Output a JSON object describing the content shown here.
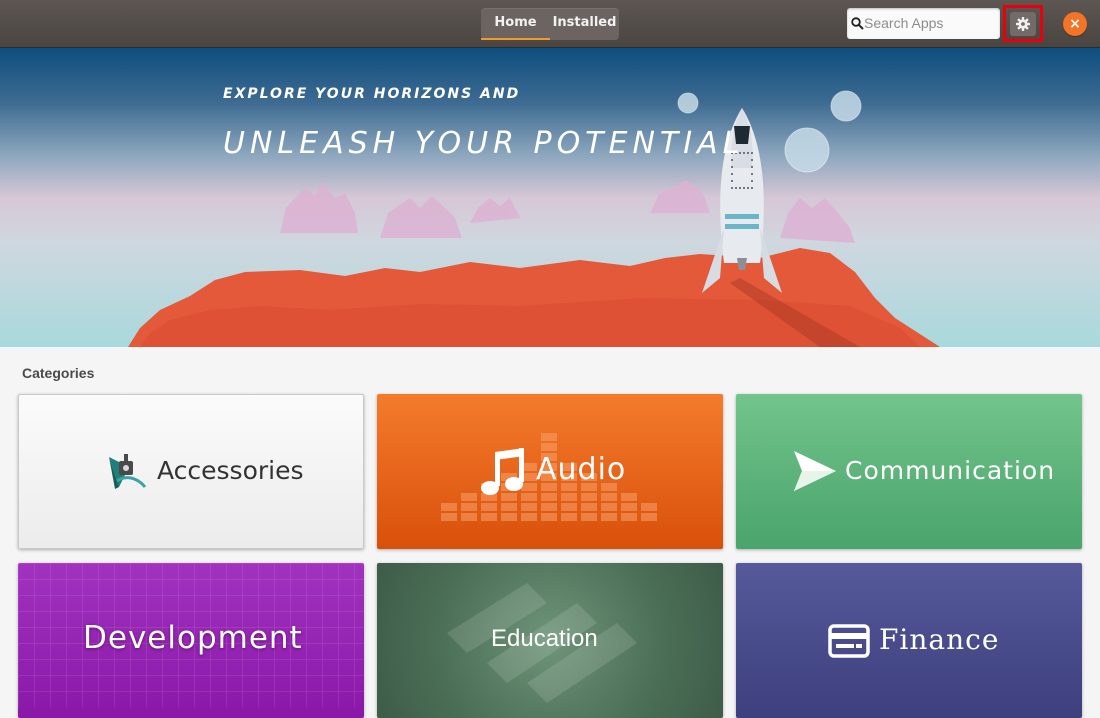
{
  "header": {
    "modes": {
      "home": "Home",
      "installed": "Installed"
    },
    "search": {
      "placeholder": "Search Apps",
      "value": ""
    },
    "icons": {
      "search": "search-icon",
      "settings": "gear-icon",
      "close": "close-icon"
    },
    "close_symbol": "×",
    "accent": "#f29a28"
  },
  "banner": {
    "line1": "EXPLORE YOUR HORIZONS AND",
    "line2": "UNLEASH YOUR POTENTIAL"
  },
  "categories": {
    "title": "Categories",
    "items": [
      {
        "label": "Accessories",
        "color": "#f3f3f3",
        "icon": "accessories-icon"
      },
      {
        "label": "Audio",
        "color": "#e8641a",
        "icon": "music-note-icon"
      },
      {
        "label": "Communication",
        "color": "#5fb47c",
        "icon": "send-icon"
      },
      {
        "label": "Development",
        "color": "#9a25b8",
        "icon": ""
      },
      {
        "label": "Education",
        "color": "#557a60",
        "icon": ""
      },
      {
        "label": "Finance",
        "color": "#4a4c8c",
        "icon": "credit-card-icon"
      }
    ]
  }
}
